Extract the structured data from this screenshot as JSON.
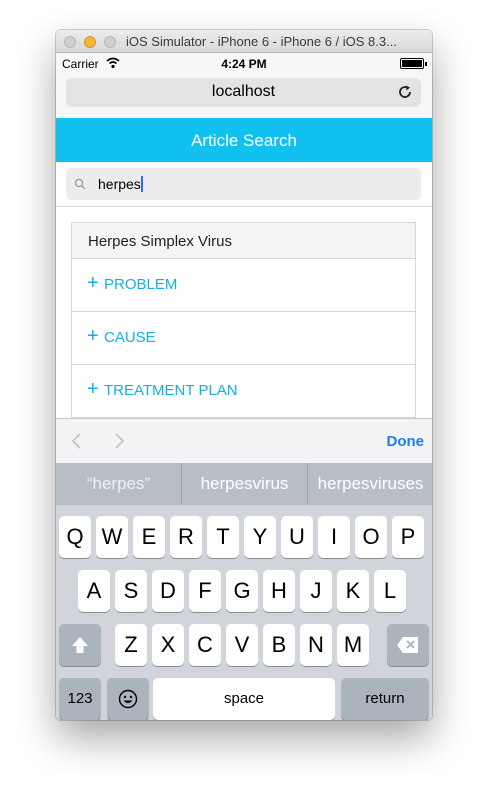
{
  "window": {
    "title": "iOS Simulator - iPhone 6 - iPhone 6 / iOS 8.3..."
  },
  "status": {
    "carrier": "Carrier",
    "time": "4:24 PM"
  },
  "browser": {
    "url": "localhost"
  },
  "app": {
    "title": "Article Search"
  },
  "search": {
    "value": "herpes"
  },
  "article": {
    "title": "Herpes Simplex Virus",
    "sections": [
      {
        "plus": "+",
        "label": "PROBLEM"
      },
      {
        "plus": "+",
        "label": "CAUSE"
      },
      {
        "plus": "+",
        "label": "TREATMENT PLAN"
      }
    ]
  },
  "accessory": {
    "done_label": "Done"
  },
  "suggestions": [
    "“herpes”",
    "herpesvirus",
    "herpesviruses"
  ],
  "keyboard": {
    "row1": [
      "Q",
      "W",
      "E",
      "R",
      "T",
      "Y",
      "U",
      "I",
      "O",
      "P"
    ],
    "row2": [
      "A",
      "S",
      "D",
      "F",
      "G",
      "H",
      "J",
      "K",
      "L"
    ],
    "row3": [
      "Z",
      "X",
      "C",
      "V",
      "B",
      "N",
      "M"
    ],
    "numbers_label": "123",
    "space_label": "space",
    "return_label": "return"
  },
  "icons": [
    "wifi-icon",
    "battery-icon",
    "reload-icon",
    "search-icon",
    "chevron-left-icon",
    "chevron-right-icon",
    "shift-icon",
    "delete-icon",
    "emoji-icon"
  ],
  "colors": {
    "accent": "#13c1f1",
    "link": "#13aee6",
    "done": "#1d7ef0"
  }
}
